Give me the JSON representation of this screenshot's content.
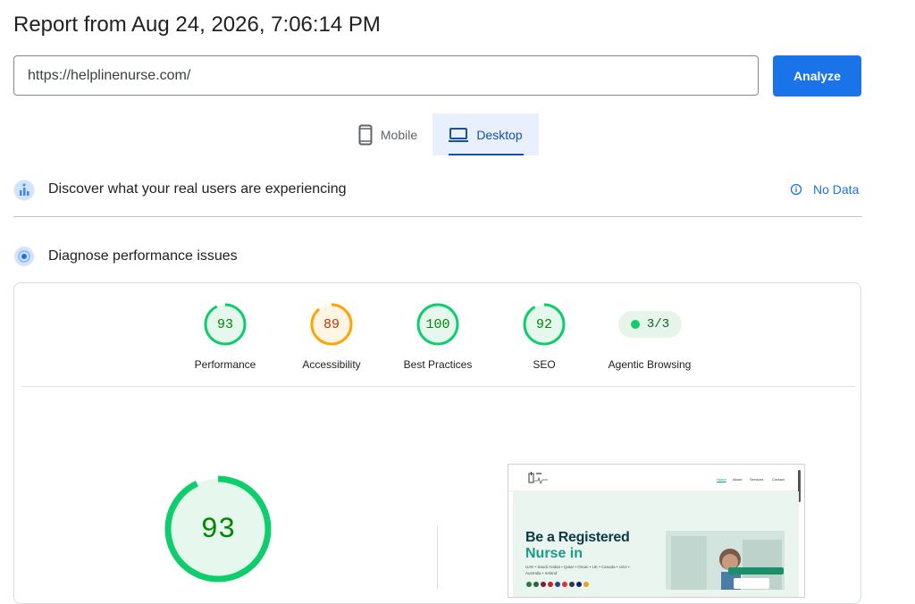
{
  "report": {
    "title": "Report from Aug 24, 2026, 7:06:14 PM"
  },
  "search": {
    "url": "https://helplinenurse.com/",
    "analyze_label": "Analyze"
  },
  "tabs": [
    {
      "label": "Mobile",
      "icon": "smartphone-icon",
      "selected": false
    },
    {
      "label": "Desktop",
      "icon": "laptop-icon",
      "selected": true
    }
  ],
  "field_data": {
    "title": "Discover what your real users are experiencing",
    "status": "No Data",
    "status_icon": "info-icon"
  },
  "lab_data": {
    "title": "Diagnose performance issues"
  },
  "categories": [
    {
      "label": "Performance",
      "score": "93",
      "value": 93,
      "color": "#0cce6b",
      "text_color": "#008800",
      "fill": "#e6f8ee"
    },
    {
      "label": "Accessibility",
      "score": "89",
      "value": 89,
      "color": "#ffa400",
      "text_color": "#c33300",
      "fill": "#fff5e5"
    },
    {
      "label": "Best Practices",
      "score": "100",
      "value": 100,
      "color": "#0cce6b",
      "text_color": "#008800",
      "fill": "#e6f8ee"
    },
    {
      "label": "SEO",
      "score": "92",
      "value": 92,
      "color": "#0cce6b",
      "text_color": "#008800",
      "fill": "#e6f8ee"
    }
  ],
  "agentic": {
    "label": "Agentic Browsing",
    "value": "3/3"
  },
  "main_score": {
    "score": "93",
    "value": 93
  },
  "screenshot": {
    "nav": [
      "Home",
      "About",
      "Services",
      "Contact"
    ],
    "heading_line1": "Be a Registered",
    "heading_line2": "Nurse in",
    "countries_line1": "UAE • Saudi Arabia • Qatar • Oman • UK • Canada • USA •",
    "countries_line2": "Australia • Ireland"
  }
}
